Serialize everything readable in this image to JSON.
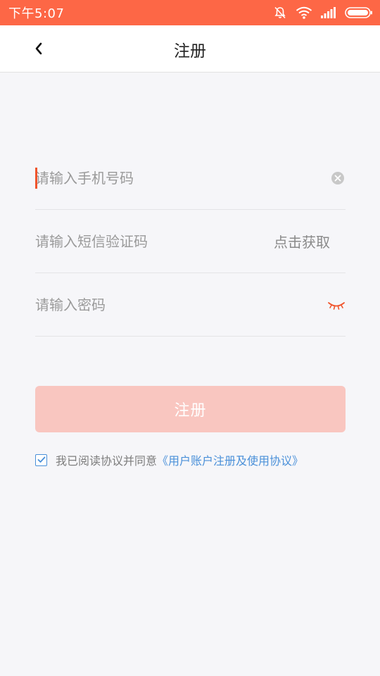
{
  "status_bar": {
    "time": "下午5:07",
    "icons": [
      "bell-off-icon",
      "wifi-icon",
      "signal-icon",
      "battery-icon"
    ],
    "background": "#fd6746"
  },
  "nav": {
    "back_icon": "chevron-left-icon",
    "title": "注册"
  },
  "form": {
    "phone": {
      "placeholder": "请输入手机号码",
      "value": "",
      "clear_icon": "clear-circle-icon"
    },
    "sms_code": {
      "placeholder": "请输入短信验证码",
      "value": "",
      "action_label": "点击获取"
    },
    "password": {
      "placeholder": "请输入密码",
      "value": "",
      "toggle_icon": "eye-closed-icon"
    }
  },
  "submit": {
    "label": "注册",
    "background": "#f9c6c0"
  },
  "agreement": {
    "checked": true,
    "text": "我已阅读协议并同意",
    "link": "《用户账户注册及使用协议》",
    "link_color": "#4a90d9"
  },
  "colors": {
    "accent": "#fd6746",
    "cursor": "#f0542c",
    "page_bg": "#f6f6f9"
  }
}
